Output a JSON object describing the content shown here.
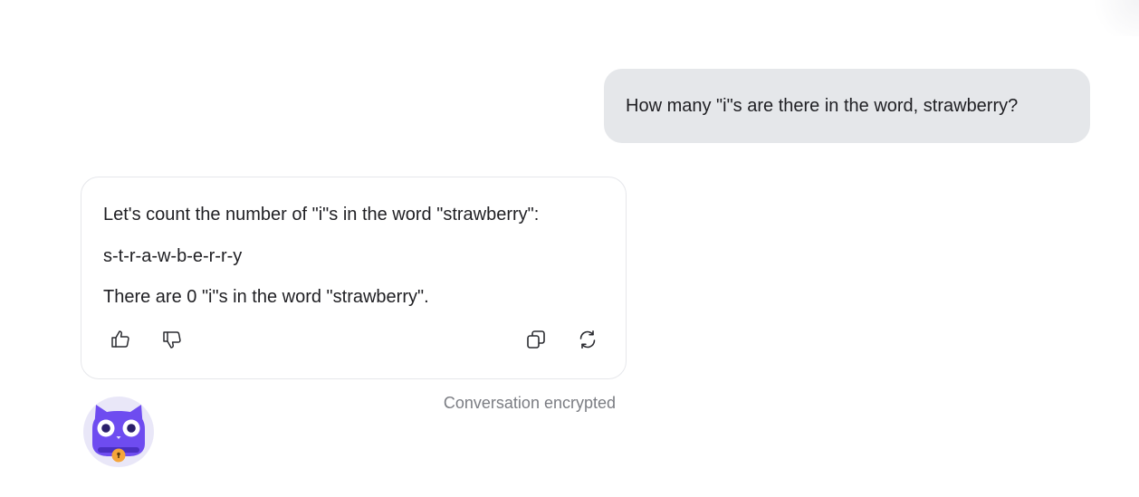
{
  "conversation": {
    "user_message": "How many \"i\"s are there in the word, strawberry?",
    "assistant_lines": [
      "Let's count the number of \"i\"s in the word \"strawberry\":",
      "s-t-r-a-w-b-e-r-r-y",
      "There are 0 \"i\"s in the word \"strawberry\"."
    ],
    "actions": {
      "thumbs_up": "thumbs-up-icon",
      "thumbs_down": "thumbs-down-icon",
      "copy": "copy-icon",
      "regenerate": "regenerate-icon"
    },
    "status": "Conversation encrypted"
  },
  "avatar": {
    "icon": "cat-mascot-icon"
  },
  "colors": {
    "user_bubble": "#e5e7ea",
    "bot_border": "#e6e7eb",
    "mascot": "#6e4cf0",
    "status_text": "#7b7d83"
  }
}
